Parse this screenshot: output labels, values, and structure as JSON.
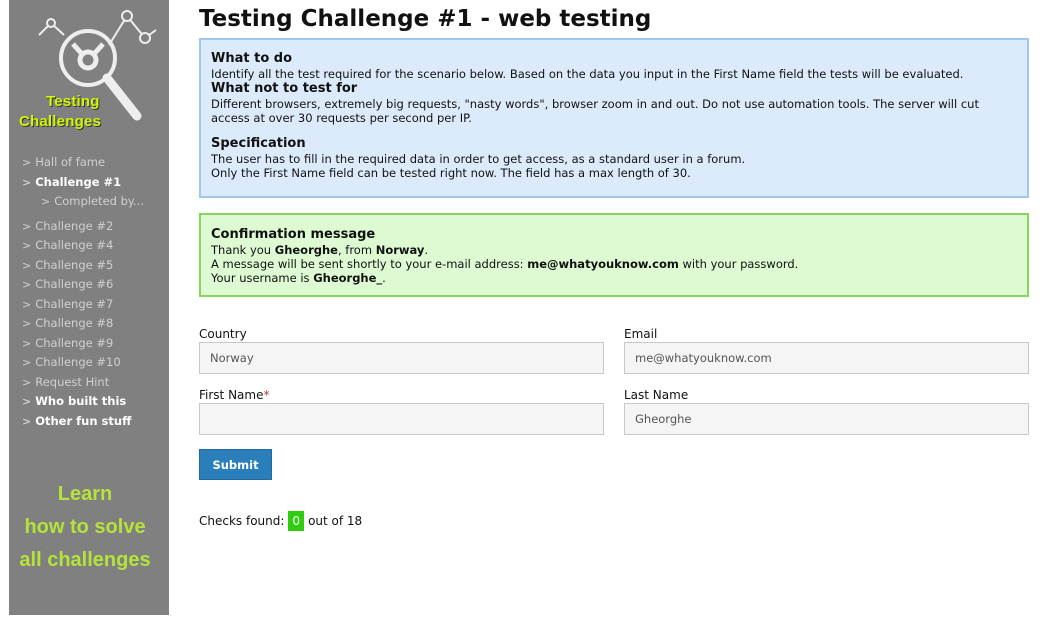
{
  "sidebar": {
    "logo": {
      "line1": "Testing",
      "line2": "Challenges",
      "icon": "magnifier-graph-icon"
    },
    "nav": [
      {
        "label": "Hall of fame",
        "style": "normal"
      },
      {
        "label": "Challenge #1",
        "style": "active"
      },
      {
        "label": "Completed by...",
        "style": "sub"
      },
      {
        "label": "Challenge #2",
        "style": "normal"
      },
      {
        "label": "Challenge #4",
        "style": "normal"
      },
      {
        "label": "Challenge #5",
        "style": "normal"
      },
      {
        "label": "Challenge #6",
        "style": "normal"
      },
      {
        "label": "Challenge #7",
        "style": "normal"
      },
      {
        "label": "Challenge #8",
        "style": "normal"
      },
      {
        "label": "Challenge #9",
        "style": "normal"
      },
      {
        "label": "Challenge #10",
        "style": "normal"
      },
      {
        "label": "Request Hint",
        "style": "normal"
      },
      {
        "label": "Who built this",
        "style": "bright"
      },
      {
        "label": "Other fun stuff",
        "style": "bright"
      }
    ],
    "chevron": ">",
    "learn": {
      "line1": "Learn",
      "line2": "how to solve",
      "line3": "all challenges"
    }
  },
  "main": {
    "title": "Testing Challenge #1 - web testing",
    "info": {
      "what_to_do_heading": "What to do",
      "what_to_do_text": "Identify all the test required for the scenario below. Based on the data you input in the First Name field the tests will be evaluated.",
      "what_not_heading": "What not to test for",
      "what_not_text": "Different browsers, extremely big requests, \"nasty words\", browser zoom in and out. Do not use automation tools. The server will cut access at over 30 requests per second per IP.",
      "spec_heading": "Specification",
      "spec_line1": "The user has to fill in the required data in order to get access, as a standard user in a forum.",
      "spec_line2": "Only the First Name field can be tested right now. The field has a max length of 30."
    },
    "confirmation": {
      "heading": "Confirmation message",
      "thank_prefix": "Thank you ",
      "name": "Gheorghe",
      "from_text": ", from ",
      "country": "Norway",
      "period": ".",
      "msg_prefix": "A message will be sent shortly to your e-mail address: ",
      "email": "me@whatyouknow.com",
      "msg_suffix": " with your password.",
      "user_prefix": "Your username is ",
      "username": "Gheorghe_",
      "user_suffix": "."
    },
    "form": {
      "country": {
        "label": "Country",
        "value": "Norway"
      },
      "email": {
        "label": "Email",
        "value": "me@whatyouknow.com"
      },
      "first_name": {
        "label": "First Name",
        "required_mark": "*",
        "value": ""
      },
      "last_name": {
        "label": "Last Name",
        "value": "Gheorghe"
      },
      "submit_label": "Submit"
    },
    "checks": {
      "prefix": "Checks found:",
      "found": "0",
      "suffix": "out of 18"
    }
  },
  "colors": {
    "sidebar_bg": "#808080",
    "logo_text": "#d4f500",
    "learn_text": "#b8e23a",
    "info_bg": "#dcebfb",
    "info_border": "#9fc9e8",
    "confirm_bg": "#ddfad3",
    "confirm_border": "#86d65c",
    "submit_bg": "#2a7fba",
    "badge_bg": "#2fcc10"
  }
}
